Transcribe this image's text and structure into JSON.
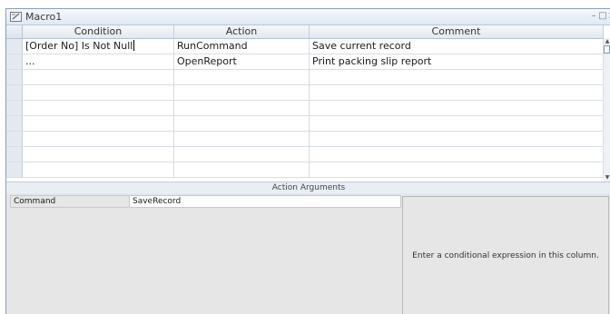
{
  "window": {
    "title": "Macro1",
    "minimize_symbol": "–",
    "restore_symbol": "□",
    "close_symbol": "×"
  },
  "grid": {
    "columns": [
      "Condition",
      "Action",
      "Comment"
    ],
    "rows": [
      {
        "condition": "[Order No] Is Not Null",
        "action": "RunCommand",
        "comment": "Save current record"
      },
      {
        "condition": "...",
        "action": "OpenReport",
        "comment": "Print packing slip report"
      },
      {
        "condition": "",
        "action": "",
        "comment": ""
      },
      {
        "condition": "",
        "action": "",
        "comment": ""
      },
      {
        "condition": "",
        "action": "",
        "comment": ""
      },
      {
        "condition": "",
        "action": "",
        "comment": ""
      },
      {
        "condition": "",
        "action": "",
        "comment": ""
      },
      {
        "condition": "",
        "action": "",
        "comment": ""
      },
      {
        "condition": "",
        "action": "",
        "comment": ""
      }
    ]
  },
  "arguments": {
    "section_title": "Action Arguments",
    "fields": [
      {
        "label": "Command",
        "value": "SaveRecord"
      }
    ],
    "help_text": "Enter a conditional expression in this column."
  },
  "icons": {
    "title_icon": "macro-icon",
    "scroll_up": "up-arrow-icon",
    "scroll_down": "down-arrow-icon"
  }
}
